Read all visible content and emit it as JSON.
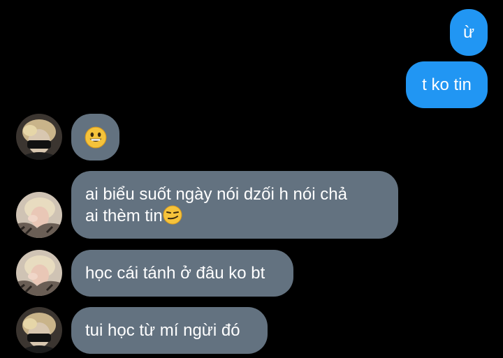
{
  "messages": [
    {
      "direction": "sent",
      "text": "ừ"
    },
    {
      "direction": "sent",
      "text": "t ko tin"
    },
    {
      "direction": "received",
      "emoji": "😀",
      "emoji_icon": "grinning-face-emoji"
    },
    {
      "direction": "received",
      "text_line1": "ai biểu suốt ngày nói dzối h nói chả",
      "text_line2": "ai thèm tin",
      "emoji_icon": "smirking-face-emoji"
    },
    {
      "direction": "received",
      "text": "học cái tánh ở đâu ko bt"
    },
    {
      "direction": "received",
      "text": "tui học từ mí ngừi đó"
    }
  ],
  "colors": {
    "background": "#000000",
    "sent_bubble": "#2196f3",
    "received_bubble": "#637280",
    "text": "#ffffff"
  },
  "avatars": [
    {
      "name": "contact-avatar-dark",
      "style": "dark"
    },
    {
      "name": "contact-avatar-light",
      "style": "light"
    }
  ]
}
